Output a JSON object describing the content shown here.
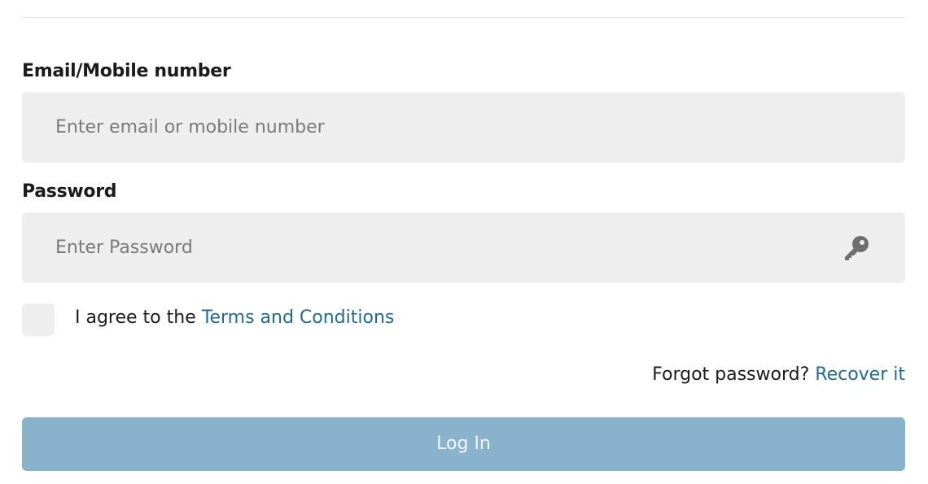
{
  "email": {
    "label": "Email/Mobile number",
    "placeholder": "Enter email or mobile number",
    "value": ""
  },
  "password": {
    "label": "Password",
    "placeholder": "Enter Password",
    "value": "",
    "icon": "key-icon"
  },
  "terms": {
    "checked": false,
    "text": "I agree to the",
    "link_label": "Terms and Conditions"
  },
  "forgot": {
    "text": "Forgot password?",
    "link_label": "Recover it"
  },
  "login_button": {
    "label": "Log In",
    "enabled": false
  },
  "colors": {
    "field_background": "#eeeeee",
    "link": "#1f6b94",
    "button_disabled": "#89b2cc"
  }
}
